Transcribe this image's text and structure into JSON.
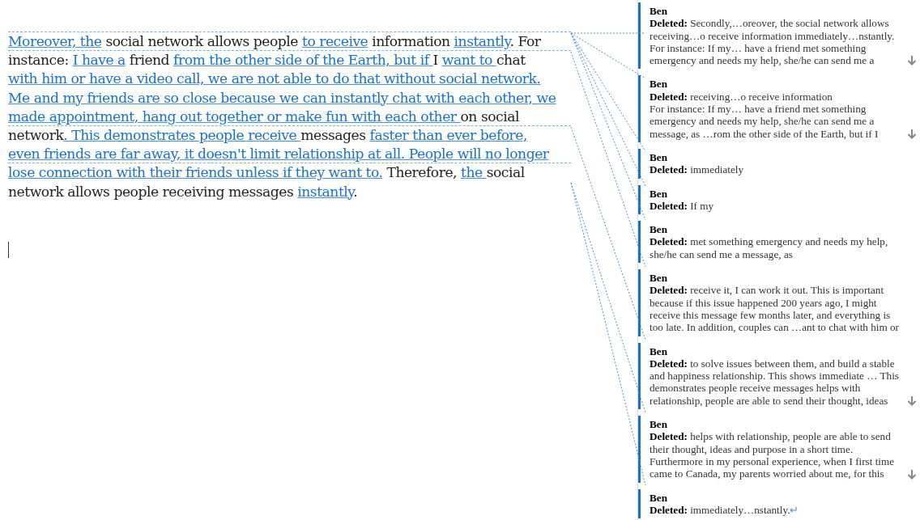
{
  "document": {
    "lines": [
      {
        "anchored": true,
        "runs": [
          {
            "text": "Moreover, the",
            "inserted": true
          },
          {
            "text": " social network allows people ",
            "inserted": false
          },
          {
            "text": "to receive",
            "inserted": true
          },
          {
            "text": " information ",
            "inserted": false
          },
          {
            "text": "instantly",
            "inserted": true
          },
          {
            "text": ". For",
            "inserted": false
          }
        ]
      },
      {
        "anchored": true,
        "runs": [
          {
            "text": "instance: ",
            "inserted": false
          },
          {
            "text": "I have a",
            "inserted": true
          },
          {
            "text": " friend ",
            "inserted": false
          },
          {
            "text": "from the other side of the Earth, but if ",
            "inserted": true
          },
          {
            "text": "I ",
            "inserted": false
          },
          {
            "text": "want to ",
            "inserted": true
          },
          {
            "text": "chat",
            "inserted": false
          }
        ]
      },
      {
        "anchored": false,
        "runs": [
          {
            "text": "with him or have a video call, we are not able to do that without social network.",
            "inserted": true
          }
        ]
      },
      {
        "anchored": false,
        "runs": [
          {
            "text": "Me and my friends are so close because we can instantly chat with each other, we",
            "inserted": true
          }
        ]
      },
      {
        "anchored": false,
        "runs": [
          {
            "text": "made appointment, hang out together or make fun with each other ",
            "inserted": true
          },
          {
            "text": "on social",
            "inserted": false
          }
        ]
      },
      {
        "anchored": true,
        "runs": [
          {
            "text": "network",
            "inserted": false
          },
          {
            "text": ". This demonstrates people receive ",
            "inserted": true
          },
          {
            "text": "messages ",
            "inserted": false
          },
          {
            "text": "faster than ever before,",
            "inserted": true
          }
        ]
      },
      {
        "anchored": false,
        "runs": [
          {
            "text": "even friends are far away, it doesn't limit relationship at all. People will no longer",
            "inserted": true
          }
        ]
      },
      {
        "anchored": true,
        "runs": [
          {
            "text": "lose connection with their friends unless if they want to.",
            "inserted": true
          },
          {
            "text": " Therefore, ",
            "inserted": false
          },
          {
            "text": "the ",
            "inserted": true
          },
          {
            "text": "social",
            "inserted": false
          }
        ]
      },
      {
        "anchored": false,
        "runs": [
          {
            "text": "network allows people receiving messages ",
            "inserted": false
          },
          {
            "text": "instantly",
            "inserted": true
          },
          {
            "text": ".",
            "inserted": false
          }
        ]
      }
    ]
  },
  "comments": [
    {
      "author": "Ben",
      "label": "Deleted:",
      "text": "Secondly,…oreover, the social network allows receiving…o receive information immediately…nstantly. For instance: If my… have a friend met something emergency and needs my help, she/he can send me a",
      "more": true
    },
    {
      "author": "Ben",
      "label": "Deleted:",
      "text": "receiving…o receive information\nFor instance: If my… have a friend met something emergency and needs my help, she/he can send me a message, as …rom the other side of the Earth, but if I",
      "more": true
    },
    {
      "author": "Ben",
      "label": "Deleted:",
      "text": "immediately",
      "more": false
    },
    {
      "author": "Ben",
      "label": "Deleted:",
      "text": "If my",
      "more": false
    },
    {
      "author": "Ben",
      "label": "Deleted:",
      "text": "met something emergency and needs my help, she/he can send me a message, as",
      "more": false
    },
    {
      "author": "Ben",
      "label": "Deleted:",
      "text": "receive it, I can work it out. This is important because if this issue happened 200 years ago, I might receive this message few months later, and everything is too late. In addition, couples can …ant to chat with him or",
      "more": false
    },
    {
      "author": "Ben",
      "label": "Deleted:",
      "text": " to solve issues between them, and build a stable and happiness relationship. This shows immediate … This demonstrates people receive messages helps with relationship, people are able to send their thought, ideas",
      "more": true
    },
    {
      "author": "Ben",
      "label": "Deleted:",
      "text": "helps with relationship, people are able to send their thought, ideas and purpose in a short time. Furthermore in my personal experience, when I first time came to Canada, my parents worried about me, for this",
      "more": true
    },
    {
      "author": "Ben",
      "label": "Deleted:",
      "text": "immediately…nstantly.",
      "more": false,
      "end_mark": "↵"
    }
  ]
}
